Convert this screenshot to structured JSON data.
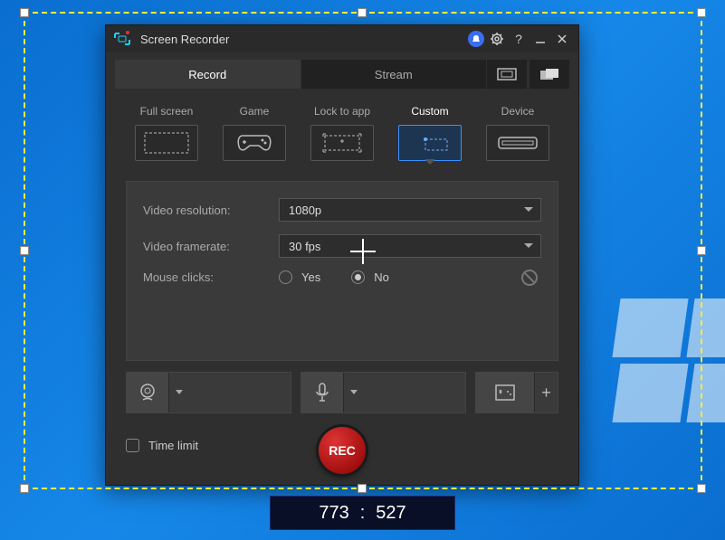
{
  "titlebar": {
    "title": "Screen Recorder"
  },
  "tabs": {
    "record": "Record",
    "stream": "Stream"
  },
  "modes": {
    "fullscreen": "Full screen",
    "game": "Game",
    "lock": "Lock to app",
    "custom": "Custom",
    "device": "Device"
  },
  "settings": {
    "resolution_label": "Video resolution:",
    "resolution_value": "1080p",
    "framerate_label": "Video framerate:",
    "framerate_value": "30 fps",
    "mouseclicks_label": "Mouse clicks:",
    "yes": "Yes",
    "no": "No"
  },
  "footer": {
    "timelimit_label": "Time limit",
    "rec": "REC"
  },
  "dimensions": {
    "w": "773",
    "sep": ":",
    "h": "527"
  }
}
